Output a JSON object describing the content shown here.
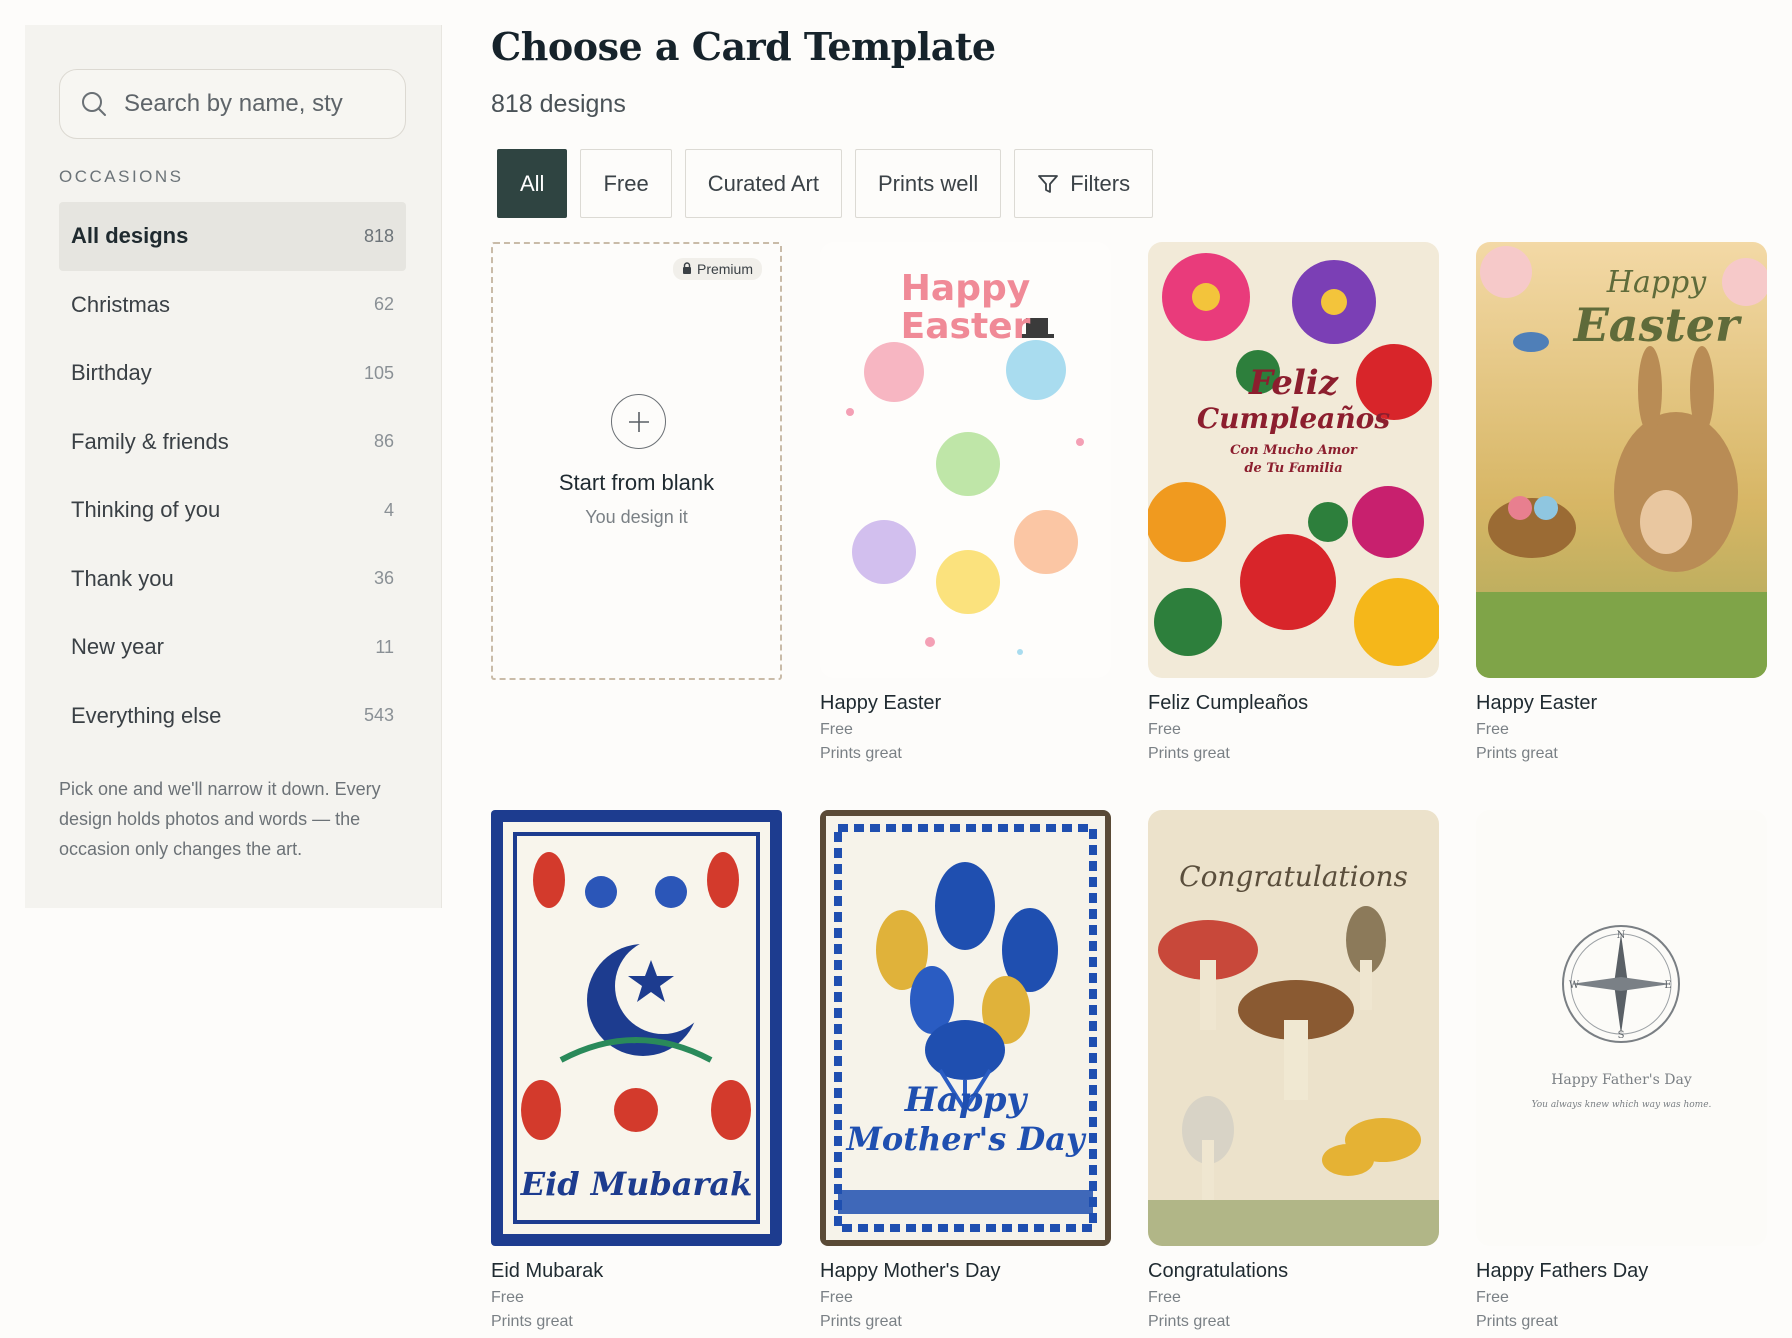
{
  "search": {
    "placeholder": "Search by name, sty"
  },
  "sidebar": {
    "section_label": "OCCASIONS",
    "items": [
      {
        "label": "All designs",
        "count": "818"
      },
      {
        "label": "Christmas",
        "count": "62"
      },
      {
        "label": "Birthday",
        "count": "105"
      },
      {
        "label": "Family & friends",
        "count": "86"
      },
      {
        "label": "Thinking of you",
        "count": "4"
      },
      {
        "label": "Thank you",
        "count": "36"
      },
      {
        "label": "New year",
        "count": "11"
      },
      {
        "label": "Everything else",
        "count": "543"
      }
    ],
    "note": "Pick one and we'll narrow it down. Every design holds photos and words — the occasion only changes the art."
  },
  "main": {
    "title": "Choose a Card Template",
    "count": "818 designs",
    "filters": [
      "All",
      "Free",
      "Curated Art",
      "Prints well",
      "Filters"
    ],
    "blank": {
      "badge": "Premium",
      "title": "Start from blank",
      "subtitle": "You design it"
    },
    "cards": [
      {
        "title": "Happy Easter",
        "price": "Free",
        "print": "Prints great",
        "art_lines": [
          "Happy",
          "Easter"
        ]
      },
      {
        "title": "Feliz Cumpleaños",
        "price": "Free",
        "print": "Prints great",
        "art_lines": [
          "Feliz",
          "Cumpleaños",
          "Con Mucho Amor",
          "de Tu Familia"
        ]
      },
      {
        "title": "Happy Easter",
        "price": "Free",
        "print": "Prints great",
        "art_lines": [
          "Happy",
          "Easter"
        ]
      },
      {
        "title": "Eid Mubarak",
        "price": "Free",
        "print": "Prints great",
        "art_lines": [
          "Eid Mubarak"
        ]
      },
      {
        "title": "Happy Mother's Day",
        "price": "Free",
        "print": "Prints great",
        "art_lines": [
          "Happy",
          "Mother's Day"
        ]
      },
      {
        "title": "Congratulations",
        "price": "Free",
        "print": "Prints great",
        "art_lines": [
          "Congratulations"
        ]
      },
      {
        "title": "Happy Fathers Day",
        "price": "Free",
        "print": "Prints great",
        "art_lines": [
          "Happy Father's Day",
          "You always knew which way was home."
        ]
      }
    ]
  },
  "colors": {
    "accent": "#2f4441",
    "sidebar_bg": "#f4f3ef",
    "active_item_bg": "#e6e5e0"
  }
}
